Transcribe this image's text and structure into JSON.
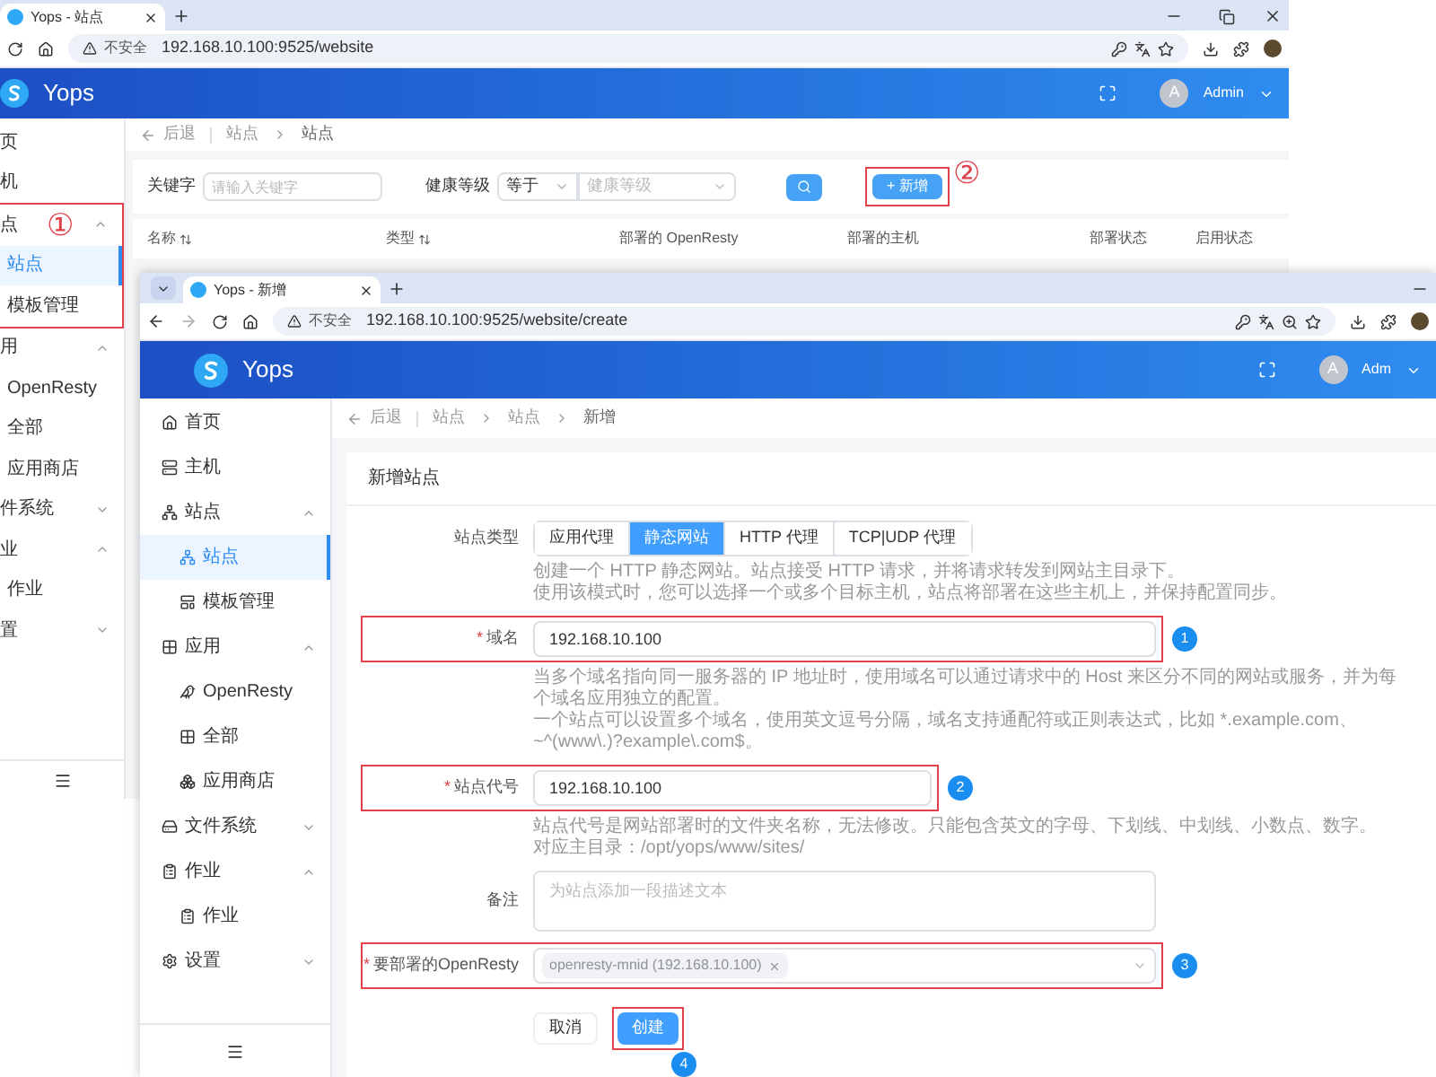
{
  "back_window": {
    "browser": {
      "tab_title": "Yops - 站点",
      "security_label": "不安全",
      "url": "192.168.10.100:9525/website"
    },
    "app_title": "Yops",
    "avatar_letter": "A",
    "user": "Admin",
    "sidebar": [
      {
        "label": "页",
        "selected": false
      },
      {
        "label": "机",
        "selected": false
      },
      {
        "label": "点",
        "selected": false,
        "expanded": true,
        "callout": "①",
        "children": [
          {
            "label": "站点",
            "selected": true
          },
          {
            "label": "模板管理",
            "selected": false
          }
        ]
      },
      {
        "label": "用",
        "selected": false,
        "expanded": true,
        "children": [
          {
            "label": "OpenResty",
            "selected": false
          },
          {
            "label": "全部",
            "selected": false
          },
          {
            "label": "应用商店",
            "selected": false
          }
        ]
      },
      {
        "label": "件系统",
        "selected": false,
        "expanded": false
      },
      {
        "label": "业",
        "selected": false,
        "expanded": true,
        "children": [
          {
            "label": "作业",
            "selected": false
          }
        ]
      },
      {
        "label": "置",
        "selected": false,
        "expanded": false
      }
    ],
    "breadcrumb": {
      "back": "后退",
      "items": [
        "站点",
        "站点"
      ]
    },
    "filters": {
      "keyword_label": "关键字",
      "keyword_placeholder": "请输入关键字",
      "health_label": "健康等级",
      "operator": "等于",
      "health_placeholder": "健康等级"
    },
    "add_button": {
      "label": "+ 新增",
      "callout": "②"
    },
    "table": {
      "columns": [
        {
          "label": "名称",
          "sortable": true
        },
        {
          "label": "类型",
          "sortable": true
        },
        {
          "label": "部署的 OpenResty",
          "sortable": false
        },
        {
          "label": "部署的主机",
          "sortable": false
        },
        {
          "label": "部署状态",
          "sortable": false
        },
        {
          "label": "启用状态",
          "sortable": false
        }
      ]
    }
  },
  "front_window": {
    "browser": {
      "tab_title": "Yops - 新增",
      "security_label": "不安全",
      "url": "192.168.10.100:9525/website/create"
    },
    "app_title": "Yops",
    "avatar_letter": "A",
    "user": "Adm",
    "sidebar": [
      {
        "label": "首页",
        "selected": false
      },
      {
        "label": "主机",
        "selected": false
      },
      {
        "label": "站点",
        "selected": false,
        "expanded": true,
        "children": [
          {
            "label": "站点",
            "selected": true
          },
          {
            "label": "模板管理",
            "selected": false
          }
        ]
      },
      {
        "label": "应用",
        "selected": false,
        "expanded": true,
        "children": [
          {
            "label": "OpenResty",
            "selected": false
          },
          {
            "label": "全部",
            "selected": false
          },
          {
            "label": "应用商店",
            "selected": false
          }
        ]
      },
      {
        "label": "文件系统",
        "selected": false,
        "expanded": false
      },
      {
        "label": "作业",
        "selected": false,
        "expanded": true,
        "children": [
          {
            "label": "作业",
            "selected": false
          }
        ]
      },
      {
        "label": "设置",
        "selected": false,
        "expanded": false
      }
    ],
    "breadcrumb": {
      "back": "后退",
      "items": [
        "站点",
        "站点",
        "新增"
      ]
    },
    "form": {
      "title": "新增站点",
      "fields": [
        {
          "kind": "segmented",
          "label": "站点类型",
          "options": [
            {
              "label": "应用代理",
              "selected": false
            },
            {
              "label": "静态网站",
              "selected": true
            },
            {
              "label": "HTTP 代理",
              "selected": false
            },
            {
              "label": "TCP|UDP 代理",
              "selected": false
            }
          ],
          "hints": [
            "创建一个 HTTP 静态网站。站点接受 HTTP 请求，并将请求转发到网站主目录下。",
            "使用该模式时，您可以选择一个或多个目标主机，站点将部署在这些主机上，并保持配置同步。"
          ]
        },
        {
          "kind": "input",
          "label": "域名",
          "required_mark": "*",
          "value": "192.168.10.100",
          "callout": "1",
          "hints": [
            "当多个域名指向同一服务器的 IP 地址时，使用域名可以通过请求中的 Host 来区分不同的网站或服务，并为每个域名应用独立的配置。",
            "一个站点可以设置多个域名，使用英文逗号分隔，域名支持通配符或正则表达式，比如 *.example.com、~^(www\\.)?example\\.com$。"
          ]
        },
        {
          "kind": "input_short",
          "label": "站点代号",
          "required_mark": "*",
          "value": "192.168.10.100",
          "callout": "2",
          "hints": [
            "站点代号是网站部署时的文件夹名称，无法修改。只能包含英文的字母、下划线、中划线、小数点、数字。",
            "对应主目录：/opt/yops/www/sites/"
          ]
        },
        {
          "kind": "textarea",
          "label": "备注",
          "placeholder": "为站点添加一段描述文本"
        },
        {
          "kind": "multiselect",
          "label": "要部署的OpenResty",
          "required_mark": "*",
          "tags": [
            "openresty-mnid (192.168.10.100)"
          ],
          "callout": "3"
        }
      ],
      "buttons": [
        {
          "label": "取消",
          "kind": "default"
        },
        {
          "label": "创建",
          "kind": "primary",
          "callout": "4"
        }
      ]
    }
  }
}
